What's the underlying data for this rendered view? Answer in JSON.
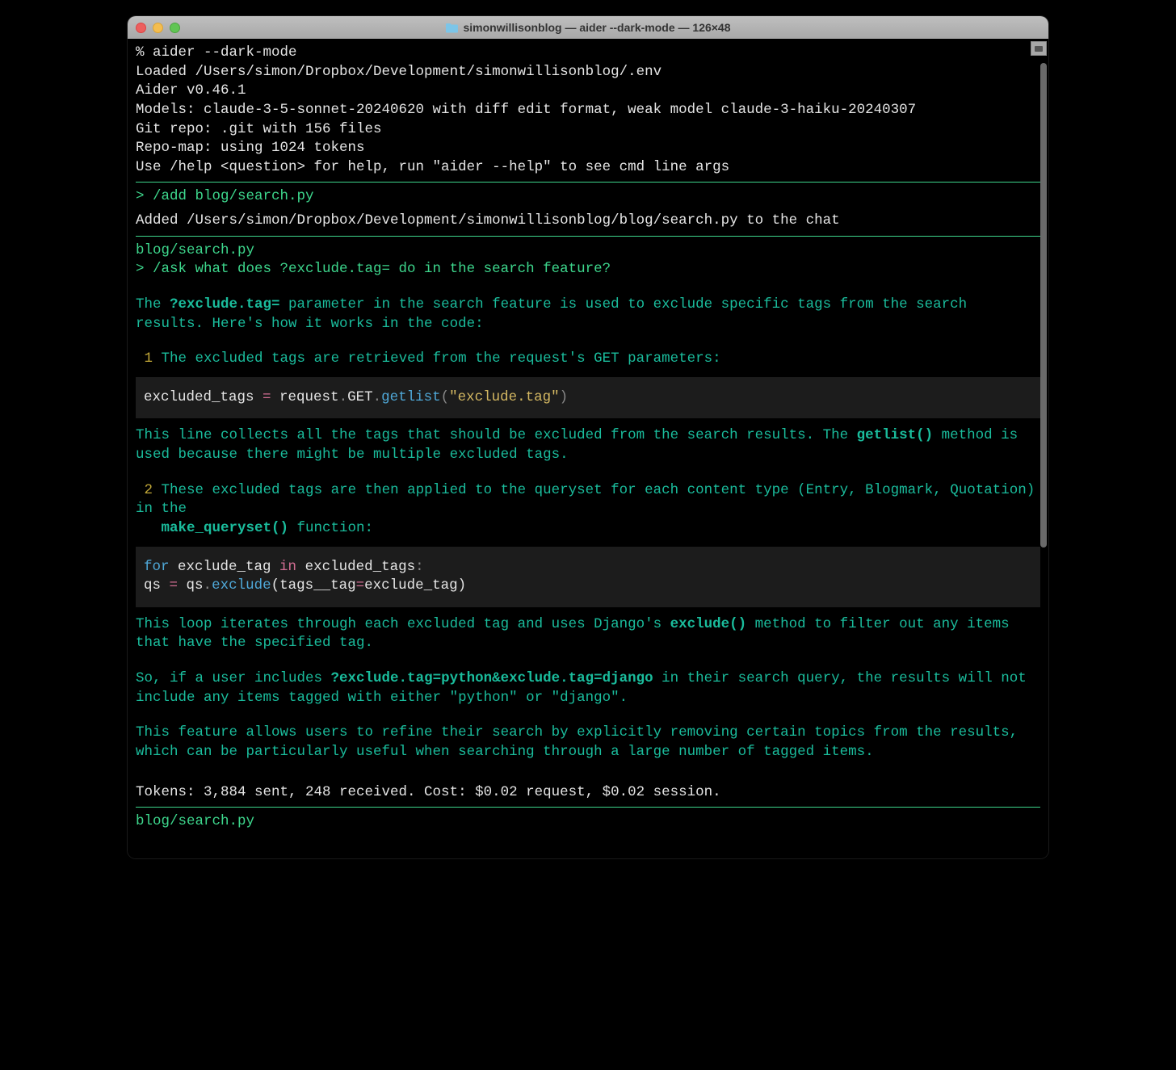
{
  "window": {
    "title": "simonwillisonblog — aider --dark-mode — 126×48"
  },
  "startup": {
    "cmd": "% aider --dark-mode",
    "loaded": "Loaded /Users/simon/Dropbox/Development/simonwillisonblog/.env",
    "version": "Aider v0.46.1",
    "models": "Models: claude-3-5-sonnet-20240620 with diff edit format, weak model claude-3-haiku-20240307",
    "repo": "Git repo: .git with 156 files",
    "repomap": "Repo-map: using 1024 tokens",
    "help": "Use /help <question> for help, run \"aider --help\" to see cmd line args"
  },
  "add": {
    "cmd": "> /add blog/search.py",
    "result": "Added /Users/simon/Dropbox/Development/simonwillisonblog/blog/search.py to the chat"
  },
  "file_context": "blog/search.py",
  "ask": {
    "cmd": "> /ask what does ?exclude.tag= do in the search feature?"
  },
  "answer": {
    "intro_pre": "The ",
    "intro_bold": "?exclude.tag=",
    "intro_post": " parameter in the search feature is used to exclude specific tags from the search results. Here's how it works in the code:",
    "step1_num": "1",
    "step1": " The excluded tags are retrieved from the request's GET parameters:",
    "code1": {
      "var": "excluded_tags",
      "eq": " = ",
      "obj": "request",
      "dot1": ".",
      "get": "GET",
      "dot2": ".",
      "method": "getlist",
      "paren_open": "(",
      "str": "\"exclude.tag\"",
      "paren_close": ")"
    },
    "para2_pre": "This line collects all the tags that should be excluded from the search results. The ",
    "para2_bold": "getlist()",
    "para2_post": " method is used because there might be multiple excluded tags.",
    "step2_num": "2",
    "step2_pre": " These excluded tags are then applied to the queryset for each content type (Entry, Blogmark, Quotation) in the ",
    "step2_bold": "make_queryset()",
    "step2_post": " function:",
    "code2": {
      "for": "for",
      "var1": " exclude_tag ",
      "in": "in",
      "var2": " excluded_tags",
      "colon": ":",
      "line2": "    qs ",
      "eq": "=",
      "line2b": " qs",
      "dot": ".",
      "method": "exclude",
      "args": "(tags__tag",
      "eq2": "=",
      "args2": "exclude_tag)"
    },
    "para3_pre": "This loop iterates through each excluded tag and uses Django's ",
    "para3_bold": "exclude()",
    "para3_post": " method to filter out any items that have the specified tag.",
    "para4_pre": "So, if a user includes ",
    "para4_bold": "?exclude.tag=python&exclude.tag=django",
    "para4_post": " in their search query, the results will not include any items tagged with either \"python\" or \"django\".",
    "para5": "This feature allows users to refine their search by explicitly removing certain topics from the results, which can be particularly useful when searching through a large number of tagged items."
  },
  "tokens": "Tokens: 3,884 sent, 248 received. Cost: $0.02 request, $0.02 session.",
  "file_context2": "blog/search.py"
}
